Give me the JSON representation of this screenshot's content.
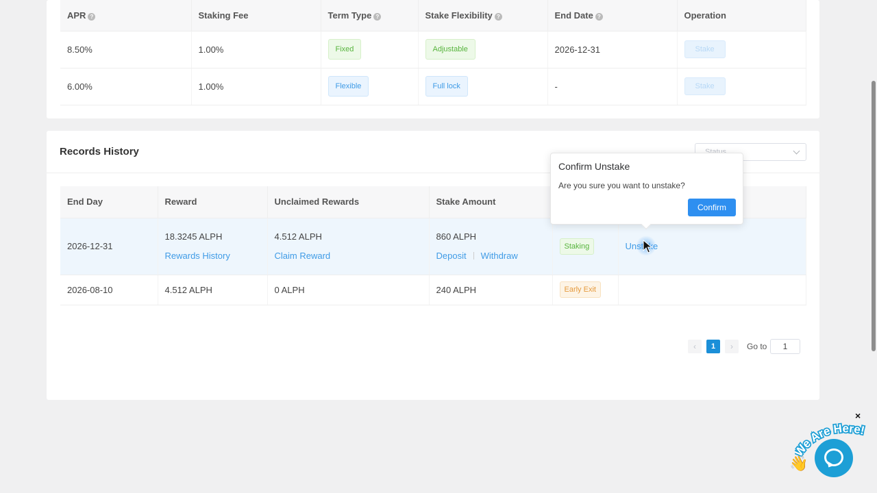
{
  "staking_table": {
    "headers": [
      {
        "label": "APR",
        "help": true
      },
      {
        "label": "Staking Fee",
        "help": false
      },
      {
        "label": "Term Type",
        "help": true
      },
      {
        "label": "Stake Flexibility",
        "help": true
      },
      {
        "label": "End Date",
        "help": true
      },
      {
        "label": "Operation",
        "help": false
      }
    ],
    "help_glyph": "?",
    "rows": [
      {
        "apr": "8.50%",
        "fee": "1.00%",
        "term": "Fixed",
        "flex": "Adjustable",
        "end": "2026-12-31",
        "op": "Stake"
      },
      {
        "apr": "6.00%",
        "fee": "1.00%",
        "term": "Flexible",
        "flex": "Full lock",
        "end": "-",
        "op": "Stake"
      }
    ]
  },
  "records": {
    "title": "Records History",
    "status_placeholder": "Status",
    "headers": [
      "End Day",
      "Reward",
      "Unclaimed Rewards",
      "Stake Amount",
      "",
      ""
    ],
    "rows": [
      {
        "end_day": "2026-12-31",
        "reward": "18.3245 ALPH",
        "reward_link": "Rewards History",
        "unclaimed": "4.512 ALPH",
        "claim_link": "Claim Reward",
        "stake": "860 ALPH",
        "deposit": "Deposit",
        "withdraw": "Withdraw",
        "status": "Staking",
        "action": "Unstake"
      },
      {
        "end_day": "2026-08-10",
        "reward": "4.512 ALPH",
        "unclaimed": "0 ALPH",
        "stake": "240 ALPH",
        "status": "Early Exit"
      }
    ]
  },
  "pagination": {
    "prev": "‹",
    "next": "›",
    "current": "1",
    "goto_label": "Go to",
    "goto_value": "1"
  },
  "popover": {
    "title": "Confirm Unstake",
    "message": "Are you sure you want to unstake?",
    "confirm": "Confirm"
  },
  "chat_widget": {
    "banner": "We Are Here!",
    "close": "×",
    "wave_emoji": "👋"
  },
  "colors": {
    "accent": "#2e8ff0",
    "primary_link": "#3f9be6",
    "green_tag": "#57b43d",
    "orange_tag": "#e59a3d",
    "chat": "#1d9fd6"
  }
}
